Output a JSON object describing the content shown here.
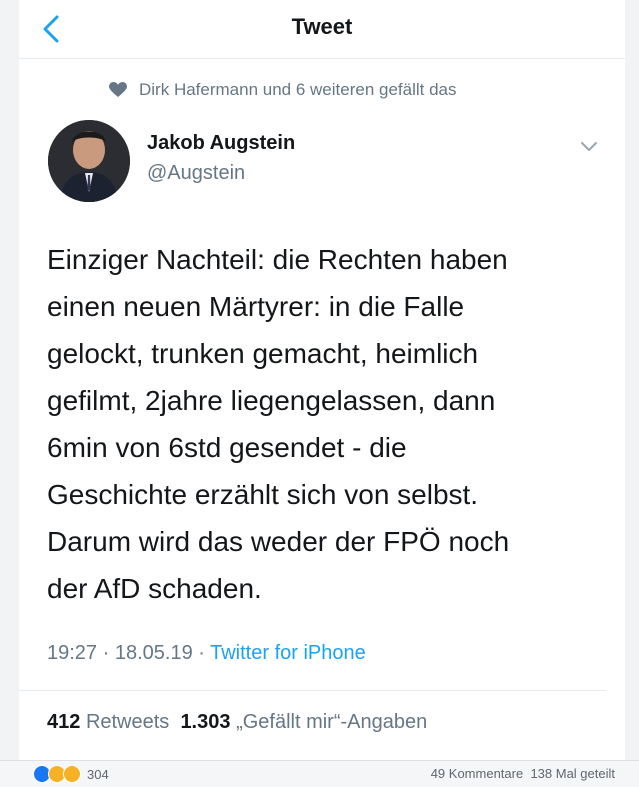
{
  "nav": {
    "title": "Tweet"
  },
  "social_context": {
    "text": "Dirk Hafermann und 6 weiteren gefällt das"
  },
  "author": {
    "name": "Jakob Augstein",
    "handle": "@Augstein"
  },
  "tweet": {
    "lines": [
      "Einziger Nachteil: die Rechten haben",
      "einen neuen Märtyrer: in die Falle",
      "gelockt, trunken gemacht, heimlich",
      "gefilmt, 2jahre liegengelassen, dann",
      "6min von 6std gesendet - die",
      "Geschichte erzählt sich von selbst.",
      "Darum wird das weder der FPÖ noch",
      "der AfD schaden."
    ],
    "time": "19:27",
    "sep1": " · ",
    "date": "18.05.19",
    "sep2": " · ",
    "source": "Twitter for iPhone"
  },
  "stats": {
    "retweets_count": "412",
    "retweets_label": "Retweets",
    "likes_count": "1.303",
    "likes_label": "„Gefällt mir“-Angaben"
  },
  "facebook": {
    "reaction_count": "304",
    "comments": "49 Kommentare",
    "shares": "138 Mal geteilt"
  },
  "icons": [
    "back-icon",
    "heart-icon",
    "chevron-down-icon",
    "like-reaction-icon",
    "haha-reaction-icon",
    "wow-reaction-icon"
  ],
  "colors": {
    "accent": "#1da1f2",
    "muted": "#657786",
    "text": "#14171a"
  }
}
